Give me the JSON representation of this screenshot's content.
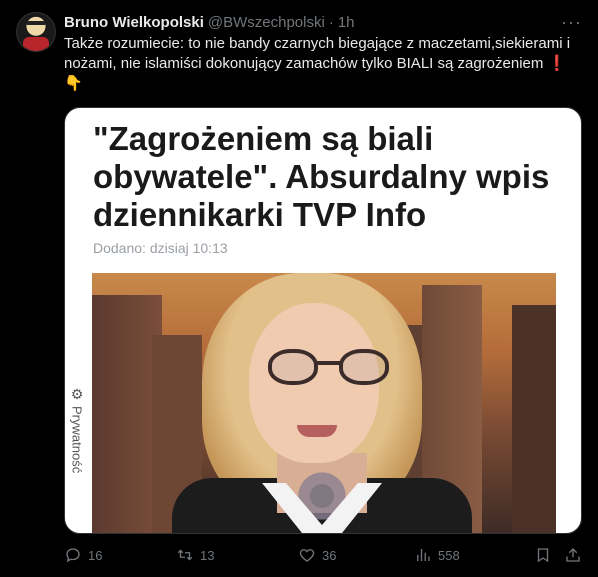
{
  "author": {
    "name": "Bruno Wielkopolski",
    "handle": "@BWszechpolski",
    "separator": "·",
    "time": "1h"
  },
  "more_icon": "more-horizontal-icon",
  "tweet": {
    "text": "Także rozumiecie: to nie bandy czarnych biegające z maczetami,siekierami i nożami, nie islamiści dokonujący zamachów tylko BIALI są zagrożeniem",
    "exclamation": "❗",
    "pointing": "👇"
  },
  "article": {
    "title": "\"Zagrożeniem są biali obywatele\". Absurdalny wpis dziennikarki TVP Info",
    "date": "Dodano: dzisiaj 10:13",
    "privacy_label": "Prywatność",
    "privacy_icon": "gear-icon"
  },
  "actions": {
    "replies": "16",
    "retweets": "13",
    "likes": "36",
    "views": "558"
  },
  "colors": {
    "background": "#000000",
    "text": "#e7e9ea",
    "muted": "#71767b",
    "exclamation": "#e0245e"
  }
}
